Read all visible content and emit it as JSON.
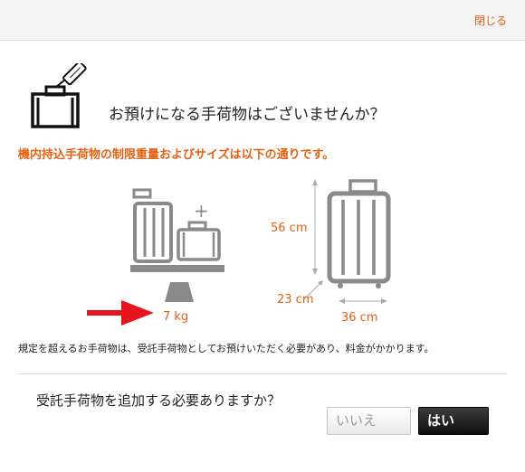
{
  "header": {
    "close_label": "閉じる"
  },
  "icons": {
    "luggage": "luggage-tag-icon",
    "arrow": "red-arrow-icon"
  },
  "question": "お預けになる手荷物はございませんか？",
  "notice": "機内持込手荷物の制限重量およびサイズは以下の通りです。",
  "illustration": {
    "weight": "7 kg",
    "height": "56 cm",
    "depth": "23 cm",
    "width": "36 cm",
    "plus": "+"
  },
  "rules_text": "規定を超えるお手荷物は、受託手荷物としてお預けいただく必要があり、料金がかかります。",
  "confirm_question": "受託手荷物を追加する必要ありますか？",
  "buttons": {
    "no_label": "いいえ",
    "yes_label": "はい"
  },
  "colors": {
    "accent": "#e46012",
    "arrow": "#e8141c",
    "gray": "#8a8a8a"
  }
}
